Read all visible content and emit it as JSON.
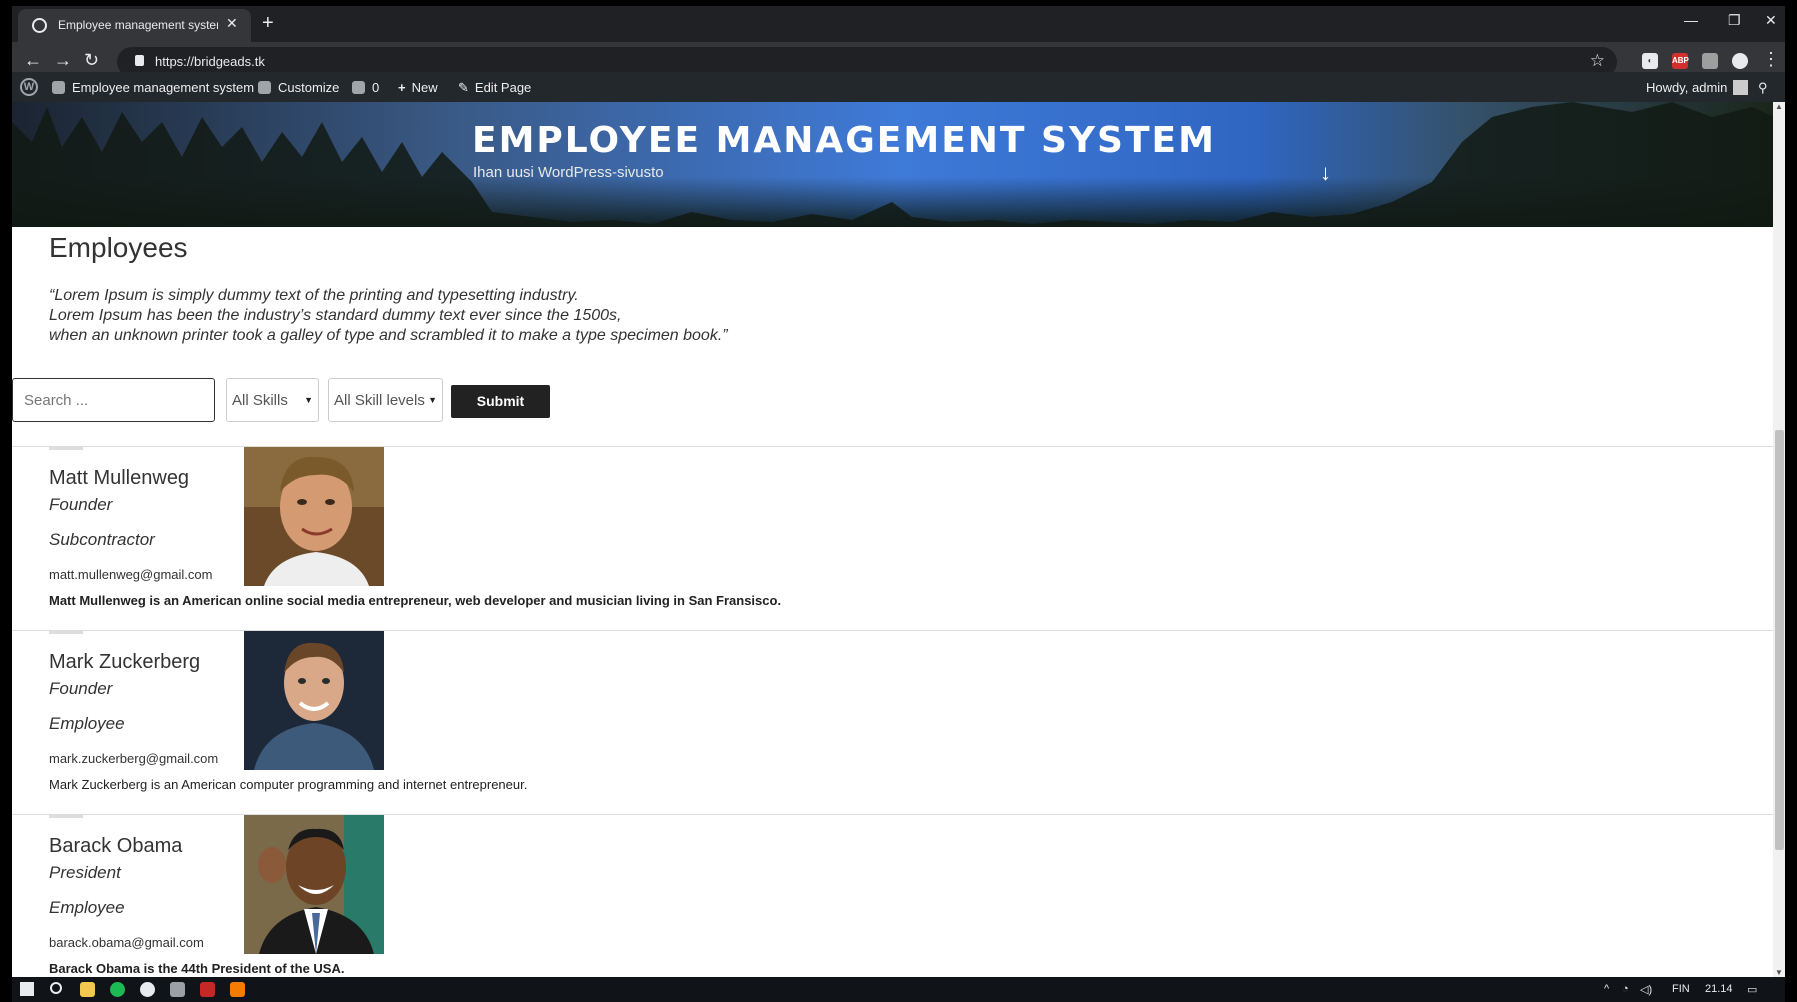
{
  "browser": {
    "tab_title": "Employee management system –",
    "url": "https://bridgeads.tk",
    "ext_abp": "ABP"
  },
  "adminbar": {
    "site_name": "Employee management system",
    "customize": "Customize",
    "comments_count": "0",
    "new": "New",
    "edit_page": "Edit Page",
    "greeting": "Howdy, admin"
  },
  "site": {
    "title": "EMPLOYEE MANAGEMENT SYSTEM",
    "description": "Ihan uusi WordPress-sivusto"
  },
  "page": {
    "title": "Employees",
    "quote_lines": [
      "“Lorem Ipsum is simply dummy text of the printing and typesetting industry.",
      "Lorem Ipsum has been the industry’s standard dummy text ever since the 1500s,",
      "when an unknown printer took a galley of type and scrambled it to make a type specimen book.”"
    ]
  },
  "filters": {
    "search_placeholder": "Search ...",
    "skills_selected": "All Skills",
    "levels_selected": "All Skill levels",
    "submit_label": "Submit"
  },
  "employees": [
    {
      "name": "Matt Mullenweg",
      "role": "Founder",
      "type": "Subcontractor",
      "email": "matt.mullenweg@gmail.com",
      "bio": "Matt Mullenweg is an American online social media entrepreneur, web developer and musician living in San Fransisco."
    },
    {
      "name": "Mark Zuckerberg",
      "role": "Founder",
      "type": "Employee",
      "email": "mark.zuckerberg@gmail.com",
      "bio": "Mark Zuckerberg is an American computer programming and internet entrepreneur."
    },
    {
      "name": "Barack Obama",
      "role": "President",
      "type": "Employee",
      "email": "barack.obama@gmail.com",
      "bio": "Barack Obama is the 44th President of the USA."
    }
  ],
  "taskbar": {
    "language": "FIN",
    "time": "21.14"
  },
  "colors": {
    "adminbar": "#23282d",
    "button": "#222222",
    "browser_chrome": "#202124"
  }
}
